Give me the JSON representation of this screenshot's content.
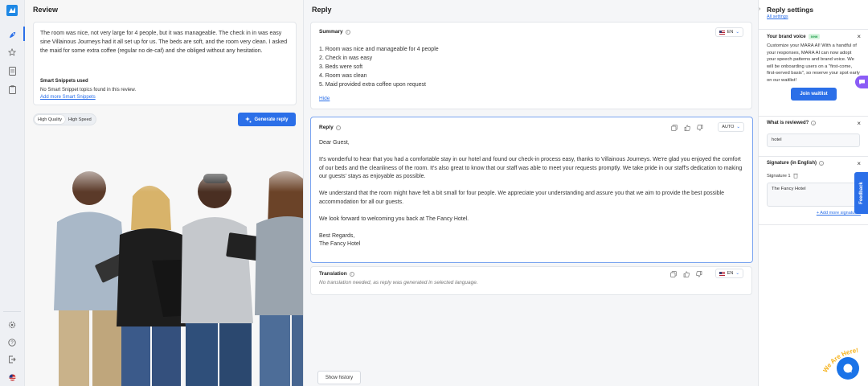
{
  "colors": {
    "primary": "#2b6fe8",
    "new_badge_bg": "#d7f5df",
    "feedback": "#2b6fe8",
    "chat": "#1a73e8"
  },
  "sidebar": {
    "icons": [
      "logo-icon",
      "rocket-icon",
      "star-icon",
      "document-icon",
      "clipboard-icon",
      "gear-icon",
      "help-icon",
      "logout-icon",
      "us-flag-icon"
    ]
  },
  "review": {
    "title": "Review",
    "text": "The room was nice, not very large for 4 people, but it was manageable. The check in in was easy sine Villainous Journeys had it all set up for us. The beds are soft, and the room very clean. I asked the maid for some extra coffee (regular no de-caf) and she obliged without any hesitation.",
    "snippets_title": "Smart Snippets used",
    "snippets_none": "No Smart Snippet topics found in this review.",
    "snippets_add": "Add more Smart Snippets",
    "quality_options": [
      "High Quality",
      "High Speed"
    ],
    "generate_label": "Generate reply"
  },
  "reply": {
    "title": "Reply",
    "summary": {
      "title": "Summary",
      "lang": "EN",
      "items": [
        "1. Room was nice and manageable for 4 people",
        "2. Check in was easy",
        "3. Beds were soft",
        "4. Room was clean",
        "5. Maid provided extra coffee upon request"
      ],
      "hide_label": "Hide"
    },
    "reply_card": {
      "title": "Reply",
      "lang": "AUTO",
      "greeting": "Dear Guest,",
      "p1": "It's wonderful to hear that you had a comfortable stay in our hotel and found our check-in process easy, thanks to Villainous Journeys. We're glad you enjoyed the comfort of our beds and the cleanliness of the room. It's also great to know that our staff was able to meet your requests promptly. We take pride in our staff's dedication to making our guests' stays as enjoyable as possible.",
      "p2": "We understand that the room might have felt a bit small for four people. We appreciate your understanding and assure you that we aim to provide the best possible accommodation for all our guests.",
      "p3": "We look forward to welcoming you back at The Fancy Hotel.",
      "sign1": "Best Regards,",
      "sign2": "The Fancy Hotel"
    },
    "translation": {
      "title": "Translation",
      "lang": "EN",
      "note": "No translation needed, as reply was generated in selected language."
    },
    "show_history": "Show history"
  },
  "settings": {
    "title": "Reply settings",
    "all_settings": "All settings",
    "brand_voice": {
      "title": "Your brand voice",
      "badge": "new",
      "text": "Customize your MARA AI! With a handful of your responses, MARA AI can now adopt your speech patterns and brand voice. We will be onboarding users on a \"first-come, first-served basis\", so reserve your spot early on our waitlist!",
      "button": "Join waitlist"
    },
    "what_reviewed": {
      "title": "What is reviewed?",
      "value": "hotel"
    },
    "signature": {
      "title": "Signature (in English)",
      "label": "Signature 1",
      "value": "The Fancy Hotel",
      "add": "+ Add more signatures"
    },
    "feedback": "Feedback",
    "we_are_here": "We Are Here!"
  }
}
